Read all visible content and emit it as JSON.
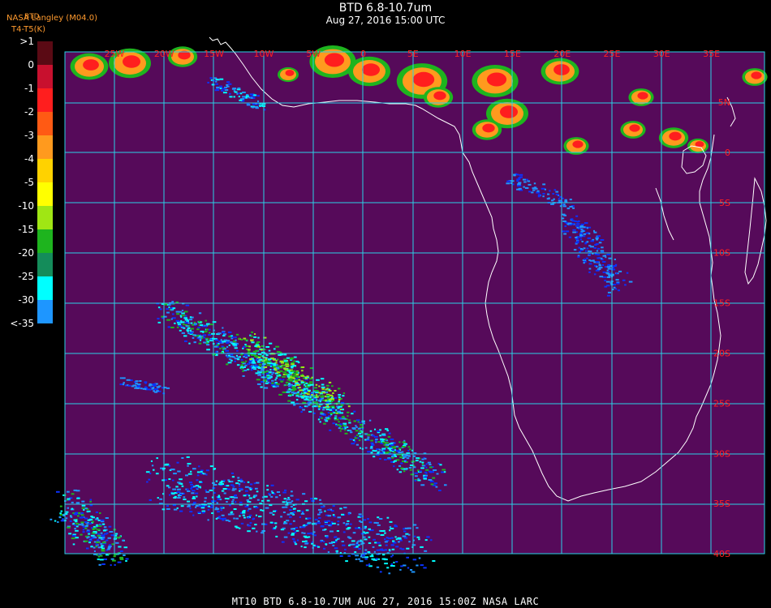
{
  "header": {
    "title": "BTD 6.8-10.7um",
    "subtitle": "Aug 27, 2016 15:00 UTC",
    "producer": "NASA Langley (M04.0)",
    "product_short": "BTD",
    "units_label": "T4-T5(K)"
  },
  "legend": {
    "labels": [
      ">1",
      "0",
      "-1",
      "-2",
      "-3",
      "-4",
      "-5",
      "-10",
      "-15",
      "-20",
      "-25",
      "-30",
      "<-35"
    ],
    "colors": [
      "#5a0a14",
      "#c8102e",
      "#ff1e1e",
      "#ff5a14",
      "#ff9a1e",
      "#ffd200",
      "#ffff00",
      "#a0e614",
      "#1eb41e",
      "#148c5a",
      "#00ffff",
      "#1e96ff",
      "#0a32ff",
      "#560a5a"
    ]
  },
  "map": {
    "lon_labels": [
      "25W",
      "20W",
      "15W",
      "10W",
      "5W",
      "0",
      "5E",
      "10E",
      "15E",
      "20E",
      "25E",
      "30E",
      "35E"
    ],
    "lat_labels": [
      "5N",
      "0",
      "5S",
      "10S",
      "15S",
      "20S",
      "25S",
      "30S",
      "35S",
      "40S"
    ],
    "background_color": "#560a5a",
    "grid_color": "#2ad2e6",
    "coast_color": "#ffffff"
  },
  "footer": {
    "text": "MT10  BTD 6.8-10.7UM   AUG 27, 2016 15:00Z   NASA LARC"
  }
}
